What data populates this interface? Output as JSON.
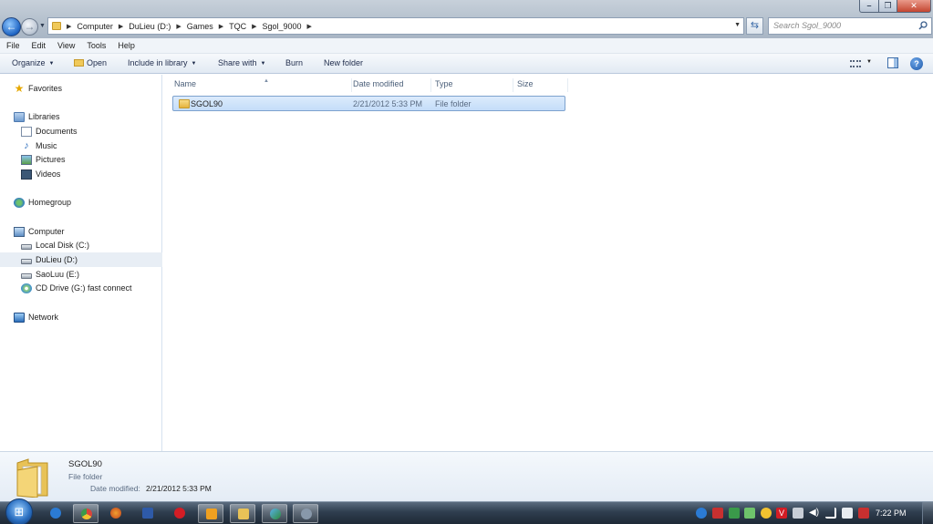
{
  "address": {
    "crumbs": [
      "Computer",
      "DuLieu (D:)",
      "Games",
      "TQC",
      "Sgol_9000"
    ],
    "search_placeholder": "Search Sgol_9000"
  },
  "menu": [
    "File",
    "Edit",
    "View",
    "Tools",
    "Help"
  ],
  "toolbar": {
    "organize": "Organize",
    "open": "Open",
    "include_in_library": "Include in library",
    "share_with": "Share with",
    "burn": "Burn",
    "new_folder": "New folder"
  },
  "nav": {
    "favorites": "Favorites",
    "libraries": "Libraries",
    "documents": "Documents",
    "music": "Music",
    "pictures": "Pictures",
    "videos": "Videos",
    "homegroup": "Homegroup",
    "computer": "Computer",
    "local_disk": "Local Disk (C:)",
    "dulieu": "DuLieu (D:)",
    "saoluu": "SaoLuu (E:)",
    "cd_drive": "CD Drive (G:) fast connect",
    "network": "Network"
  },
  "columns": [
    "Name",
    "Date modified",
    "Type",
    "Size"
  ],
  "files": [
    {
      "name": "SGOL90",
      "date": "2/21/2012 5:33 PM",
      "type": "File folder",
      "size": ""
    }
  ],
  "details": {
    "name": "SGOL90",
    "type": "File folder",
    "date_label": "Date modified:",
    "date": "2/21/2012 5:33 PM"
  },
  "taskbar": {
    "clock": "7:22 PM",
    "icons": [
      "internet-explorer-icon",
      "chrome-icon",
      "firefox-icon",
      "k-app-icon",
      "opera-icon",
      "media-player-icon",
      "explorer-icon",
      "utility-icon",
      "app-icon"
    ]
  },
  "colors": {
    "selection": "#cce4fb",
    "selection_border": "#7da2ce",
    "taskbar": "#2f3e4f"
  }
}
